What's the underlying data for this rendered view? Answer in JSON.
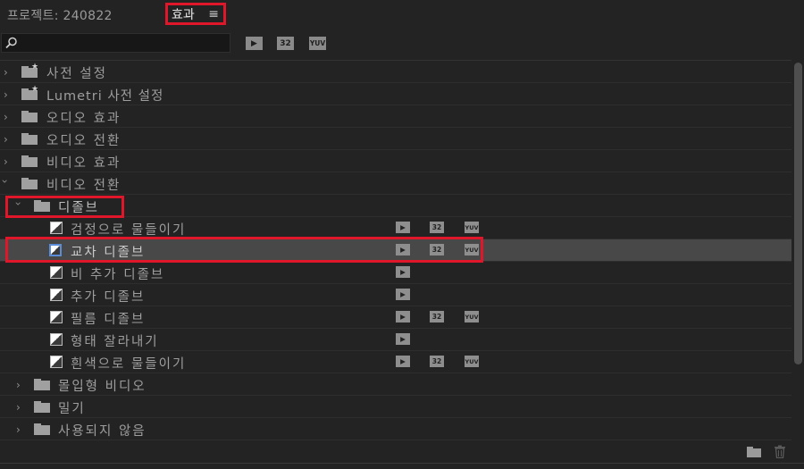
{
  "tabs": {
    "project": "프로젝트: 240822",
    "effects": "효과",
    "menu_icon": "≡"
  },
  "search": {
    "value": "",
    "placeholder": ""
  },
  "toolbar": {
    "badge_accel": "▶",
    "badge_32": "32",
    "badge_yuv": "YUV"
  },
  "tree": [
    {
      "label": "사전 설정",
      "type": "folder",
      "expanded": false,
      "starred": true
    },
    {
      "label": "Lumetri 사전 설정",
      "type": "folder",
      "expanded": false,
      "starred": true
    },
    {
      "label": "오디오 효과",
      "type": "folder",
      "expanded": false
    },
    {
      "label": "오디오 전환",
      "type": "folder",
      "expanded": false
    },
    {
      "label": "비디오 효과",
      "type": "folder",
      "expanded": false
    },
    {
      "label": "비디오 전환",
      "type": "folder",
      "expanded": true
    },
    {
      "label": "디졸브",
      "type": "subfolder",
      "expanded": true
    },
    {
      "label": "검정으로 물들이기",
      "type": "effect",
      "accel": true,
      "b32": true,
      "yuv": true
    },
    {
      "label": "교차 디졸브",
      "type": "effect",
      "selected": true,
      "accel": true,
      "b32": true,
      "yuv": true
    },
    {
      "label": "비 추가 디졸브",
      "type": "effect",
      "accel": true,
      "b32": false,
      "yuv": false
    },
    {
      "label": "추가 디졸브",
      "type": "effect",
      "accel": true,
      "b32": false,
      "yuv": false
    },
    {
      "label": "필름 디졸브",
      "type": "effect",
      "accel": true,
      "b32": true,
      "yuv": true
    },
    {
      "label": "형태 잘라내기",
      "type": "effect",
      "accel": true,
      "b32": false,
      "yuv": false
    },
    {
      "label": "흰색으로 물들이기",
      "type": "effect",
      "accel": true,
      "b32": true,
      "yuv": true
    },
    {
      "label": "몰입형 비디오",
      "type": "subfolder",
      "expanded": false
    },
    {
      "label": "밀기",
      "type": "subfolder",
      "expanded": false
    },
    {
      "label": "사용되지 않음",
      "type": "subfolder",
      "expanded": false
    }
  ],
  "colors": {
    "highlight": "#e0162b",
    "background": "#232323",
    "selected_row": "#484848"
  }
}
